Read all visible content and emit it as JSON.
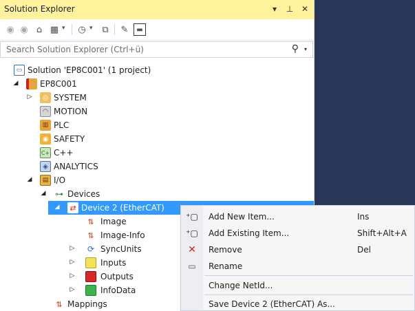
{
  "panel": {
    "title": "Solution Explorer",
    "search_placeholder": "Search Solution Explorer (Ctrl+ü)"
  },
  "toolbar": {
    "icons": [
      "back-icon",
      "forward-icon",
      "home-icon",
      "switch-views-icon",
      "pending-changes-filter-icon",
      "collapse-all-icon",
      "properties-icon",
      "preview-icon"
    ]
  },
  "tree": [
    {
      "label": "Solution 'EP8C001' (1 project)",
      "icon": "solution-icon"
    },
    {
      "label": "EP8C001",
      "icon": "project-icon",
      "expanded": true
    },
    {
      "label": "SYSTEM",
      "icon": "system-icon",
      "expanded": false
    },
    {
      "label": "MOTION",
      "icon": "motion-icon"
    },
    {
      "label": "PLC",
      "icon": "plc-icon"
    },
    {
      "label": "SAFETY",
      "icon": "safety-icon"
    },
    {
      "label": "C++",
      "icon": "cpp-icon"
    },
    {
      "label": "ANALYTICS",
      "icon": "analytics-icon"
    },
    {
      "label": "I/O",
      "icon": "io-icon",
      "expanded": true
    },
    {
      "label": "Devices",
      "icon": "devices-icon",
      "expanded": true
    },
    {
      "label": "Device 2 (EtherCAT)",
      "icon": "ethercat-device-icon",
      "expanded": true,
      "selected": true
    },
    {
      "label": "Image",
      "icon": "image-icon"
    },
    {
      "label": "Image-Info",
      "icon": "image-info-icon"
    },
    {
      "label": "SyncUnits",
      "icon": "syncunits-icon",
      "expanded": false
    },
    {
      "label": "Inputs",
      "icon": "inputs-icon",
      "expanded": false
    },
    {
      "label": "Outputs",
      "icon": "outputs-icon",
      "expanded": false
    },
    {
      "label": "InfoData",
      "icon": "infodata-icon",
      "expanded": false
    },
    {
      "label": "Mappings",
      "icon": "mappings-icon"
    }
  ],
  "context_menu": [
    {
      "label": "Add New Item...",
      "shortcut": "Ins",
      "icon": "add-new-item-icon"
    },
    {
      "label": "Add Existing Item...",
      "shortcut": "Shift+Alt+A",
      "icon": "add-existing-item-icon"
    },
    {
      "label": "Remove",
      "shortcut": "Del",
      "icon": "remove-icon"
    },
    {
      "label": "Rename",
      "shortcut": "",
      "icon": "rename-icon"
    },
    {
      "label": "Change NetId...",
      "shortcut": ""
    },
    {
      "label": "Save Device 2 (EtherCAT) As...",
      "shortcut": ""
    }
  ],
  "colors": {
    "title_bg": "#fff29d",
    "selection": "#3399ff",
    "background_panel": "#2a3657"
  }
}
